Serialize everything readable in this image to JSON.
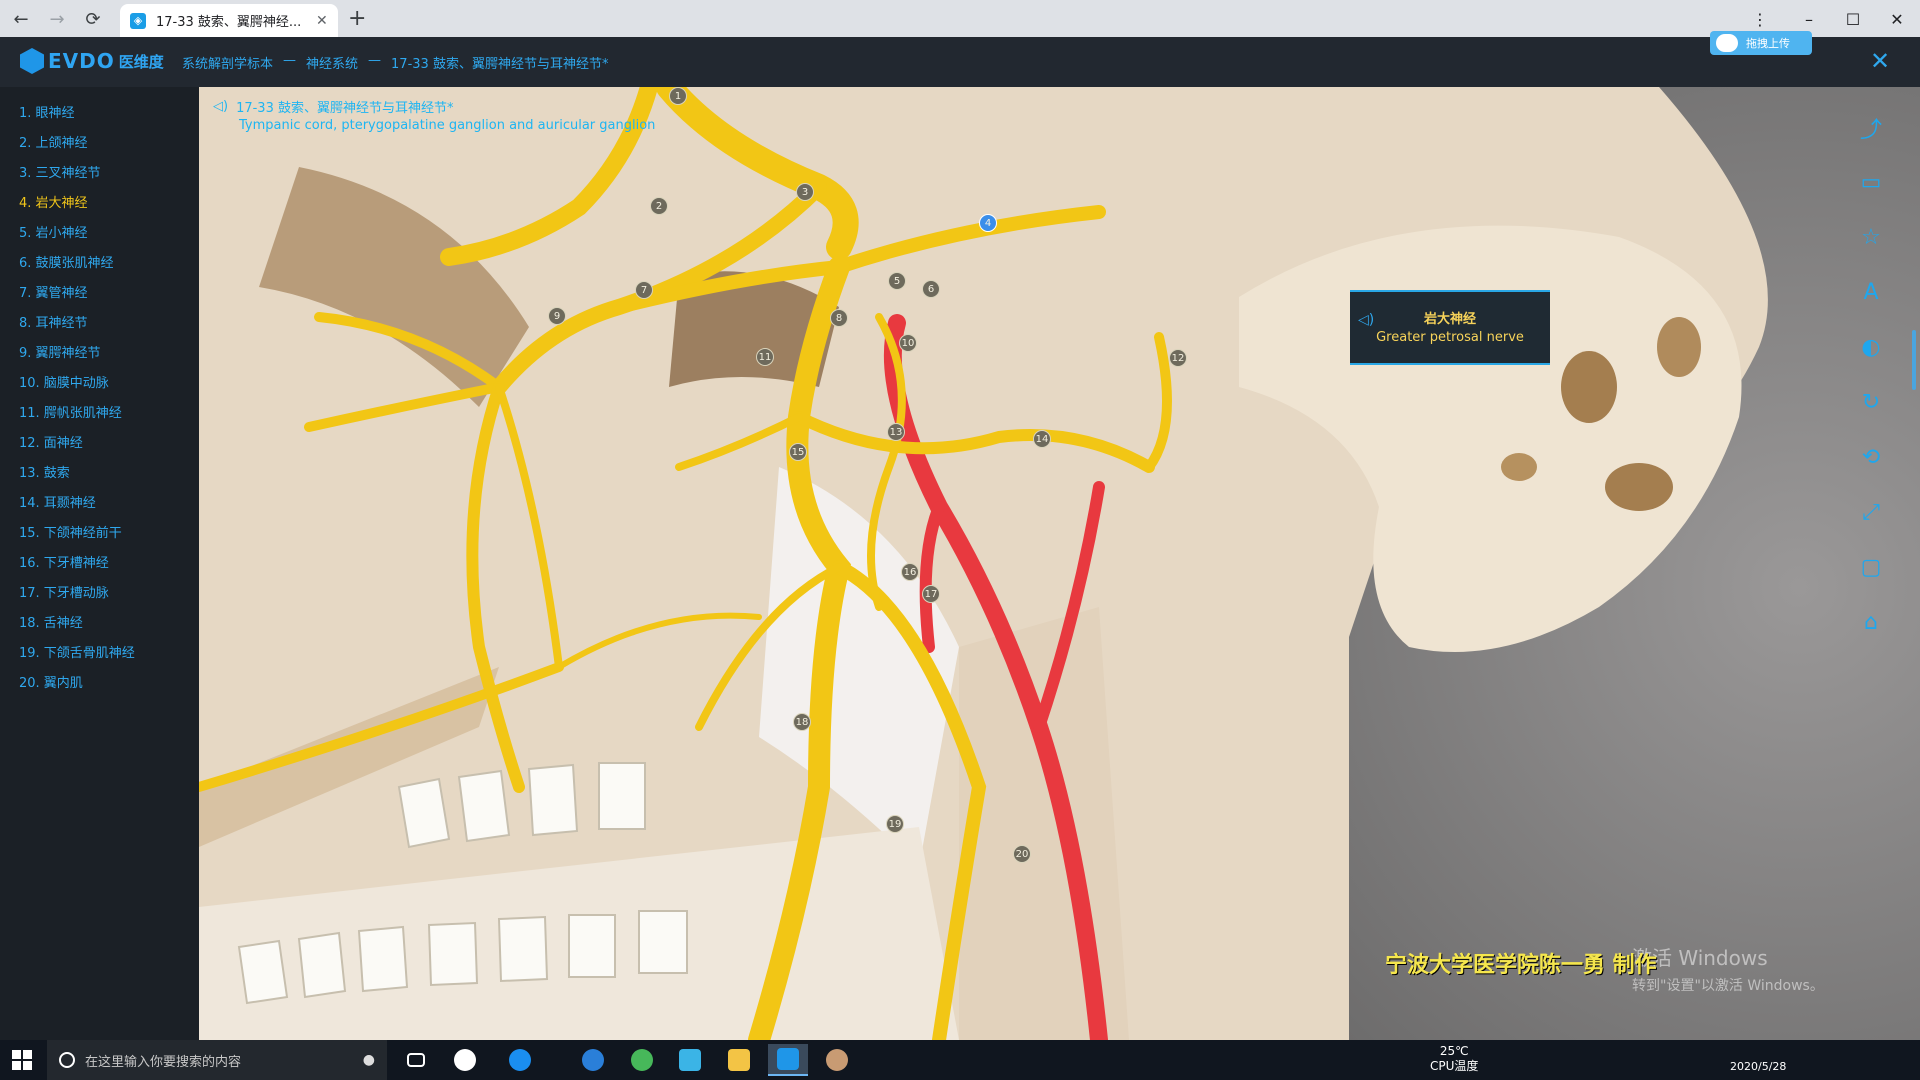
{
  "browser": {
    "tab_title": "17-33 鼓索、翼腭神经...",
    "new_tab": "+",
    "back": "←",
    "forward": "→",
    "reload": "⟳",
    "menu": "⋮",
    "minimize": "–",
    "maximize": "☐",
    "close": "✕"
  },
  "app": {
    "brand": "EVDO",
    "brand_cn": "医维度",
    "breadcrumb": [
      "系统解剖学标本",
      "神经系统",
      "17-33 鼓索、翼腭神经节与耳神经节*"
    ],
    "breadcrumb_sep": "—",
    "upload_label": "拖拽上传",
    "close_label": "✕"
  },
  "sidebar": {
    "items": [
      "1. 眼神经",
      "2. 上颌神经",
      "3. 三叉神经节",
      "4. 岩大神经",
      "5. 岩小神经",
      "6. 鼓膜张肌神经",
      "7. 翼管神经",
      "8. 耳神经节",
      "9. 翼腭神经节",
      "10. 脑膜中动脉",
      "11. 腭帆张肌神经",
      "12. 面神经",
      "13. 鼓索",
      "14. 耳颞神经",
      "15. 下颌神经前干",
      "16. 下牙槽神经",
      "17. 下牙槽动脉",
      "18. 舌神经",
      "19. 下颌舌骨肌神经",
      "20. 翼内肌"
    ],
    "active_index": 3
  },
  "viewport": {
    "title_cn": "17-33 鼓索、翼腭神经节与耳神经节*",
    "title_en": "Tympanic cord, pterygopalatine ganglion and auricular ganglion",
    "pins": [
      "1",
      "2",
      "3",
      "4",
      "5",
      "6",
      "7",
      "8",
      "9",
      "10",
      "11",
      "12",
      "13",
      "14",
      "15",
      "16",
      "17",
      "18",
      "19",
      "20"
    ],
    "selected_pin": "4",
    "tooltip": {
      "cn": "岩大神经",
      "en": "Greater petrosal nerve"
    },
    "colors": {
      "nerve": "#f2c615",
      "artery": "#e8393f",
      "bone": "#e9ded0",
      "accent": "#2fa8ee"
    }
  },
  "toolbar": [
    "share-icon",
    "screen-icon",
    "star-icon",
    "font-size-icon",
    "palette-icon",
    "rotate-icon",
    "reset-icon",
    "fullscreen-icon",
    "comment-icon",
    "home-icon"
  ],
  "watermark": {
    "line1": "激活 Windows",
    "line2": "转到\"设置\"以激活 Windows。"
  },
  "credit": "宁波大学医学院陈一勇 制作",
  "taskbar": {
    "search_placeholder": "在这里输入你要搜索的内容",
    "temp": "25℃",
    "temp_label": "CPU温度",
    "date": "2020/5/28"
  }
}
